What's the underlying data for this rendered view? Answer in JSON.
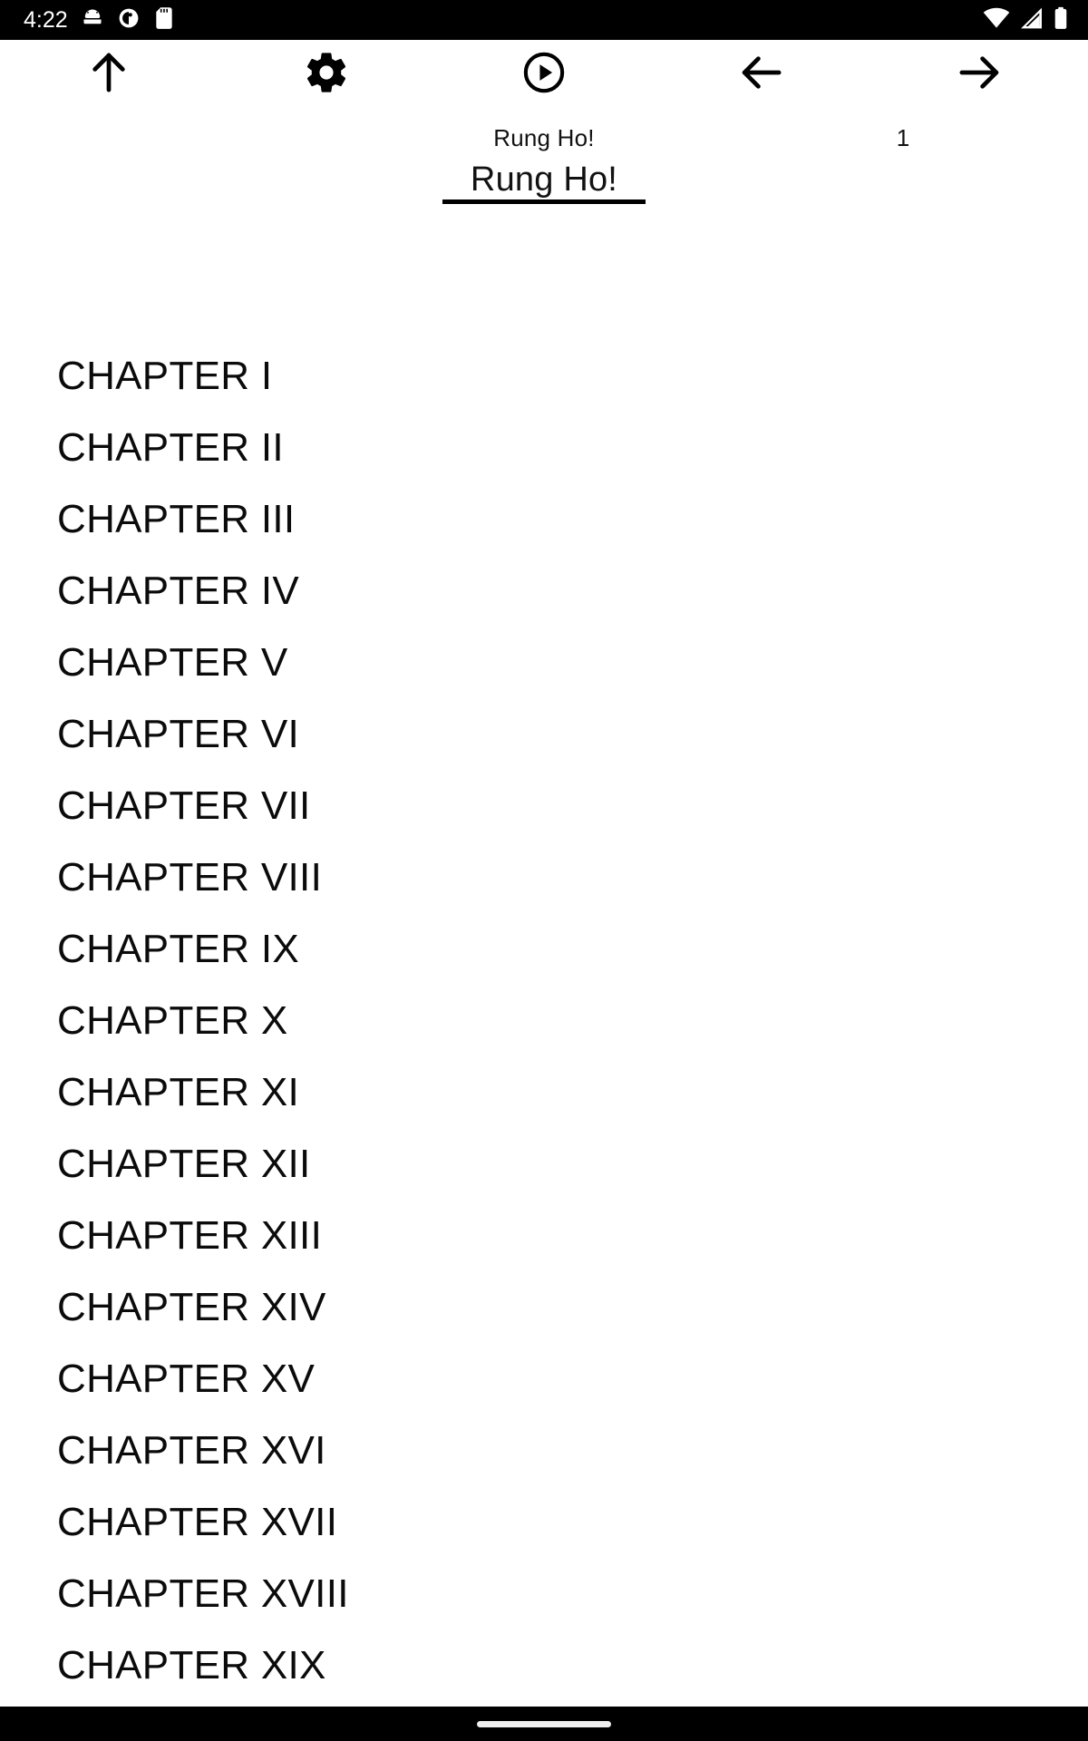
{
  "status_bar": {
    "time": "4:22",
    "left_icons": [
      "android-head-icon",
      "clock-circle-icon",
      "sd-card-icon"
    ],
    "right_icons": [
      "wifi-icon",
      "cellular-signal-icon",
      "battery-icon"
    ],
    "background_color": "#000000",
    "foreground_color": "#ffffff"
  },
  "toolbar": {
    "buttons": [
      {
        "name": "scroll-to-top-button",
        "icon": "arrow-up-icon",
        "label": ""
      },
      {
        "name": "settings-button",
        "icon": "gear-icon",
        "label": ""
      },
      {
        "name": "play-button",
        "icon": "play-circle-icon",
        "label": ""
      },
      {
        "name": "previous-button",
        "icon": "arrow-left-icon",
        "label": ""
      },
      {
        "name": "next-button",
        "icon": "arrow-right-icon",
        "label": ""
      }
    ]
  },
  "tabstrip": {
    "book_title_small": "Rung Ho!",
    "active_tab_label": "Rung Ho!",
    "page_counter": "1",
    "indicator_color": "#000000"
  },
  "content": {
    "chapters": [
      {
        "label": "CHAPTER I"
      },
      {
        "label": "CHAPTER II"
      },
      {
        "label": "CHAPTER III"
      },
      {
        "label": "CHAPTER IV"
      },
      {
        "label": "CHAPTER V"
      },
      {
        "label": "CHAPTER VI"
      },
      {
        "label": "CHAPTER VII"
      },
      {
        "label": "CHAPTER VIII"
      },
      {
        "label": "CHAPTER IX"
      },
      {
        "label": "CHAPTER X"
      },
      {
        "label": "CHAPTER XI"
      },
      {
        "label": "CHAPTER XII"
      },
      {
        "label": "CHAPTER XIII"
      },
      {
        "label": "CHAPTER XIV"
      },
      {
        "label": "CHAPTER XV"
      },
      {
        "label": "CHAPTER XVI"
      },
      {
        "label": "CHAPTER XVII"
      },
      {
        "label": "CHAPTER XVIII"
      },
      {
        "label": "CHAPTER XIX"
      }
    ]
  },
  "nav_bar": {
    "home_indicator": "home-indicator-pill",
    "background_color": "#000000"
  }
}
